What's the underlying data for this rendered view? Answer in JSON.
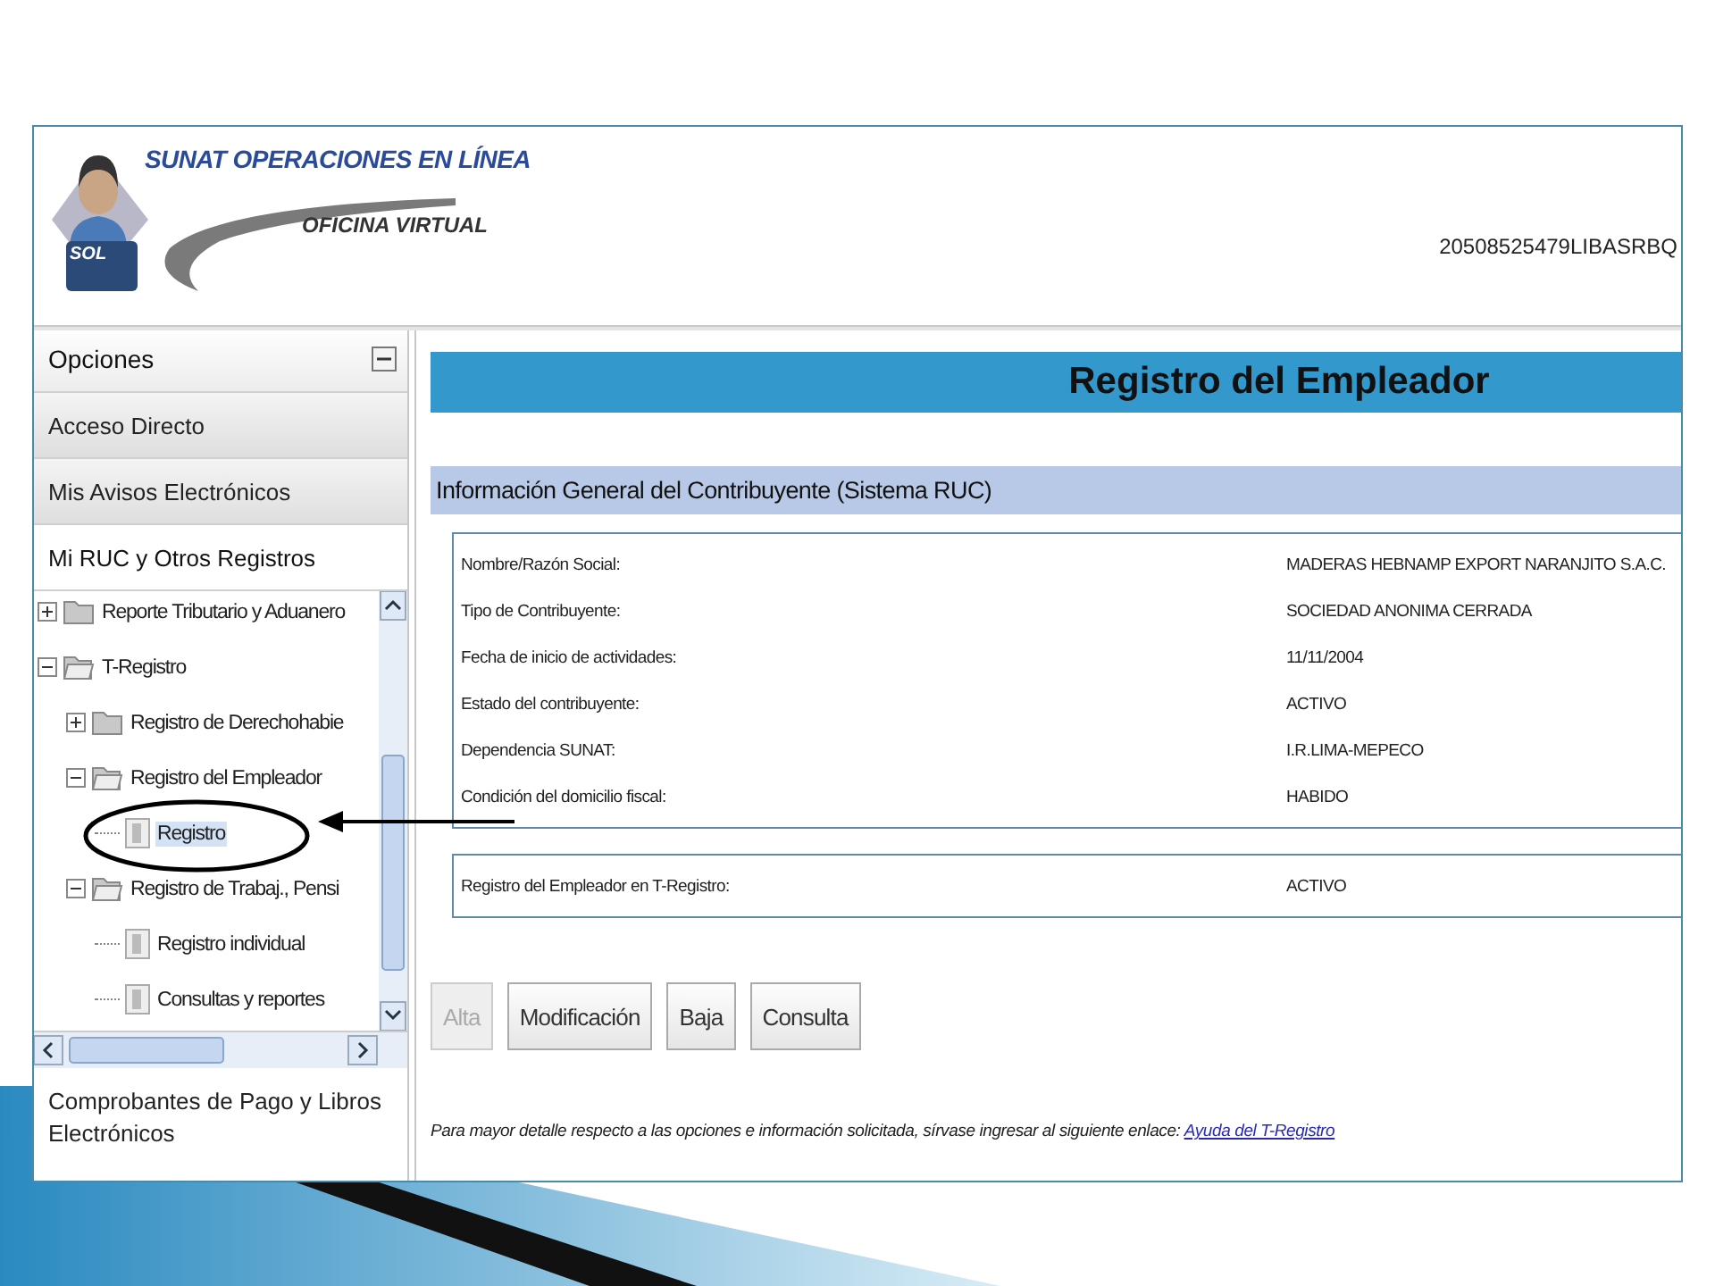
{
  "header": {
    "title": "SUNAT OPERACIONES EN LÍNEA",
    "subtitle": "OFICINA VIRTUAL",
    "logo_badge": "SOL",
    "user_code": "20508525479LIBASRBQ"
  },
  "sidebar": {
    "heading": "Opciones",
    "expanded": true,
    "sections": [
      {
        "label": "Acceso Directo",
        "selected": false
      },
      {
        "label": "Mis Avisos Electrónicos",
        "selected": false
      },
      {
        "label": "Mi RUC y Otros Registros",
        "selected": true
      }
    ],
    "tree": [
      {
        "label": "Reporte Tributario y Aduanero",
        "kind": "folder",
        "expanded": false,
        "selected": false
      },
      {
        "label": "T-Registro",
        "kind": "folder",
        "expanded": true,
        "selected": false,
        "children": [
          {
            "label": "Registro de Derechohabie",
            "kind": "folder",
            "expanded": false,
            "selected": false
          },
          {
            "label": "Registro del Empleador",
            "kind": "folder",
            "expanded": true,
            "selected": false,
            "children": [
              {
                "label": "Registro",
                "kind": "document",
                "selected": true
              }
            ]
          },
          {
            "label": "Registro de Trabaj., Pensi",
            "kind": "folder",
            "expanded": true,
            "selected": false,
            "children": [
              {
                "label": "Registro individual",
                "kind": "document",
                "selected": false
              },
              {
                "label": "Consultas y reportes",
                "kind": "document",
                "selected": false
              }
            ]
          }
        ]
      }
    ],
    "footer_section": "Comprobantes de Pago y Libros Electrónicos"
  },
  "main": {
    "title": "Registro del Empleador",
    "section_title": "Información General del Contribuyente (Sistema RUC)",
    "fields": [
      {
        "label": "Nombre/Razón Social:",
        "value": "MADERAS HEBNAMP EXPORT NARANJITO S.A.C."
      },
      {
        "label": "Tipo de Contribuyente:",
        "value": "SOCIEDAD ANONIMA CERRADA"
      },
      {
        "label": "Fecha de inicio de actividades:",
        "value": "11/11/2004"
      },
      {
        "label": "Estado del contribuyente:",
        "value": "ACTIVO"
      },
      {
        "label": "Dependencia SUNAT:",
        "value": "I.R.LIMA-MEPECO"
      },
      {
        "label": "Condición del domicilio fiscal:",
        "value": "HABIDO"
      }
    ],
    "employer_fields": [
      {
        "label": "Registro del Empleador en T-Registro:",
        "value": "ACTIVO"
      }
    ],
    "buttons": [
      {
        "label": "Alta",
        "disabled": true
      },
      {
        "label": "Modificación",
        "disabled": false
      },
      {
        "label": "Baja",
        "disabled": false
      },
      {
        "label": "Consulta",
        "disabled": false
      }
    ],
    "note": "Para mayor detalle respecto a las opciones e información solicitada, sírvase ingresar al siguiente enlace:",
    "note_link": "Ayuda del T-Registro"
  }
}
